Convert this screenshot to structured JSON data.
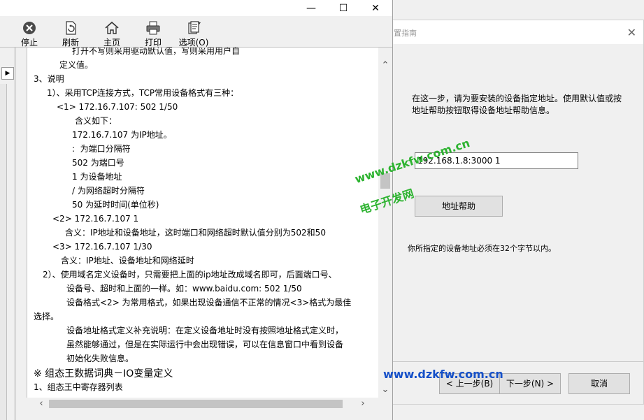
{
  "wizard": {
    "title": "置指南",
    "description": "在这一步，请为要安装的设备指定地址。使用默认值或按地址帮助按钮取得设备地址帮助信息。",
    "address_value": "192.168.1.8:3000 1",
    "help_button": "地址帮助",
    "note": "你所指定的设备地址必须在32个字节以内。",
    "back_button": "< 上一步(B)",
    "next_button": "下一步(N) >",
    "cancel_button": "取消"
  },
  "help_window": {
    "toolbar": {
      "stop": "停止",
      "refresh": "刷新",
      "home": "主页",
      "print": "打印",
      "options": "选项(O)"
    },
    "content_lines": [
      "打开不写则采用驱动默认值，写则采用用户自",
      "定义值。",
      "3、说明",
      "1）、采用TCP连接方式，TCP常用设备格式有三种：",
      "<1> 172.16.7.107: 502 1/50",
      "含义如下：",
      "172.16.7.107 为IP地址。",
      ":  为端口分隔符",
      "502 为端口号",
      "1 为设备地址",
      "/ 为网络超时分隔符",
      "50 为延时时间(单位秒)",
      "<2> 172.16.7.107 1",
      "含义：IP地址和设备地址，这时端口和网络超时默认值分别为502和50",
      "<3> 172.16.7.107 1/30",
      "含义：IP地址、设备地址和网络延时",
      "2）、使用域名定义设备时，只需要把上面的ip地址改成域名即可，后面端口号、",
      "设备号、超时和上面的一样。如：www.baidu.com: 502 1/50",
      "设备格式<2> 为常用格式，如果出现设备通信不正常的情况<3>格式为最佳",
      "选择。",
      "设备地址格式定义补充说明：在定义设备地址时没有按照地址格式定义时，",
      "虽然能够通过，但是在实际运行中会出现错误，可以在信息窗口中看到设备",
      "初始化失败信息。",
      "※ 组态王数据词典－IO变量定义",
      "1、组态王中寄存器列表"
    ]
  },
  "watermarks": {
    "url_green": "www.dzkfw.com.cn",
    "site_name": "电子开发网",
    "url_blue": "www.dzkfw.com.cn"
  }
}
